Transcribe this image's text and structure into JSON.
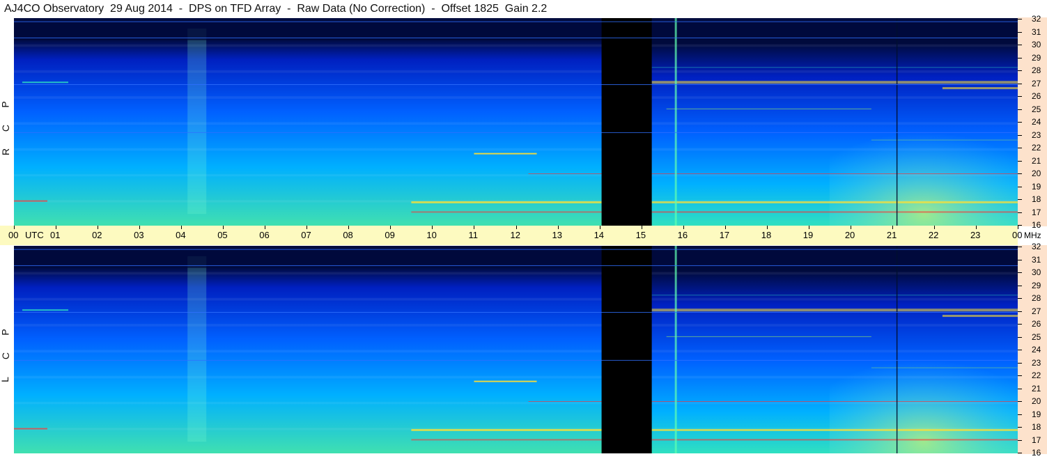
{
  "title": "AJ4CO Observatory  29 Aug 2014  -  DPS on TFD Array  -  Raw Data (No Correction)  -  Offset 1825  Gain 2.2",
  "chart_data": [
    {
      "type": "heatmap",
      "name": "RCP",
      "side_label": "R C P",
      "x_ticks": [
        "00",
        "01",
        "02",
        "03",
        "04",
        "05",
        "06",
        "07",
        "08",
        "09",
        "10",
        "11",
        "12",
        "13",
        "14",
        "15",
        "16",
        "17",
        "18",
        "19",
        "20",
        "21",
        "22",
        "23",
        "00"
      ],
      "x_unit": "UTC",
      "xlim": [
        0,
        24
      ],
      "y_ticks": [
        16,
        17,
        18,
        19,
        20,
        21,
        22,
        23,
        24,
        25,
        26,
        27,
        28,
        29,
        30,
        31,
        32
      ],
      "y_unit": "MHz",
      "ylim": [
        16,
        32
      ],
      "colormap": [
        "#000a3c",
        "#0020c0",
        "#0060ff",
        "#00b0ff",
        "#30e0c0",
        "#a0f060",
        "#ffe030",
        "#ff3030",
        "#ffffff"
      ],
      "data_gaps_utc": [
        [
          14.05,
          15.25
        ]
      ],
      "bright_bands_mhz": [
        27,
        21.5,
        20,
        17.8,
        17,
        25,
        28.2
      ],
      "vertical_lines_utc": [
        15.8,
        21.1
      ]
    },
    {
      "type": "heatmap",
      "name": "LCP",
      "side_label": "L C P",
      "x_ticks": [
        "00",
        "01",
        "02",
        "03",
        "04",
        "05",
        "06",
        "07",
        "08",
        "09",
        "10",
        "11",
        "12",
        "13",
        "14",
        "15",
        "16",
        "17",
        "18",
        "19",
        "20",
        "21",
        "22",
        "23",
        "00"
      ],
      "x_unit": "UTC",
      "xlim": [
        0,
        24
      ],
      "y_ticks": [
        16,
        17,
        18,
        19,
        20,
        21,
        22,
        23,
        24,
        25,
        26,
        27,
        28,
        29,
        30,
        31,
        32
      ],
      "y_unit": "MHz",
      "ylim": [
        16,
        32
      ],
      "colormap": [
        "#000a3c",
        "#0020c0",
        "#0060ff",
        "#00b0ff",
        "#30e0c0",
        "#a0f060",
        "#ffe030",
        "#ff3030",
        "#ffffff"
      ],
      "data_gaps_utc": [
        [
          14.05,
          15.25
        ]
      ],
      "bright_bands_mhz": [
        27,
        21.5,
        20,
        17.8,
        17,
        25,
        28.2
      ],
      "vertical_lines_utc": [
        15.8,
        21.1
      ]
    }
  ]
}
